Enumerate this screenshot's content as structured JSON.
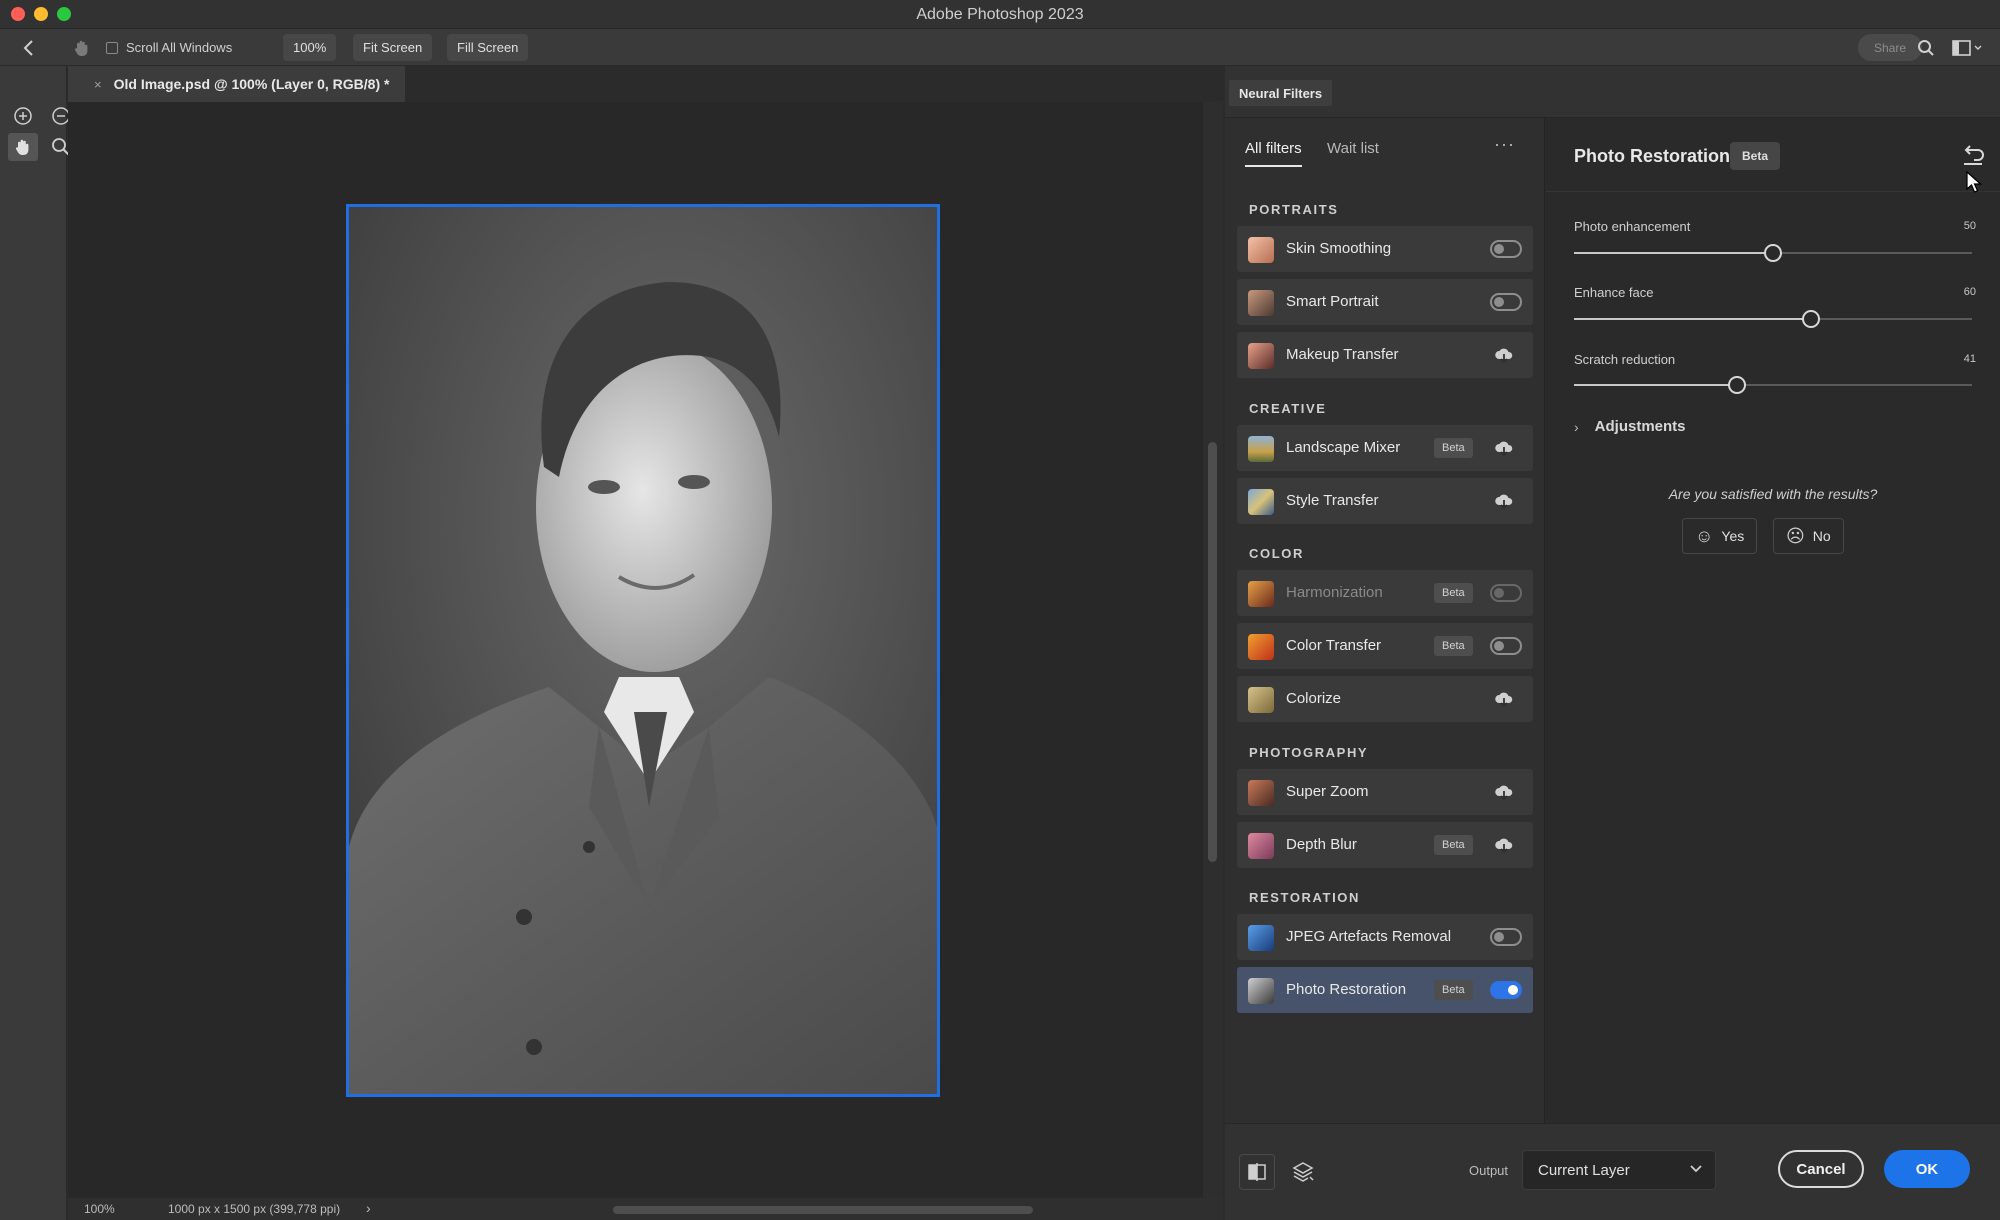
{
  "window": {
    "title": "Adobe Photoshop 2023"
  },
  "options_bar": {
    "scroll_all_windows": "Scroll All Windows",
    "zoom_100": "100%",
    "fit_screen": "Fit Screen",
    "fill_screen": "Fill Screen",
    "share": "Share"
  },
  "document": {
    "tab_title": "Old Image.psd @ 100% (Layer 0, RGB/8) *",
    "close_symbol": "×"
  },
  "status_bar": {
    "zoom": "100%",
    "doc_info": "1000 px x 1500 px (399,778 ppi)",
    "arrow": "›"
  },
  "neural_filters": {
    "panel_tab": "Neural Filters",
    "tabs": [
      "All filters",
      "Wait list"
    ],
    "more": "···",
    "beta_label": "Beta",
    "sections": [
      {
        "label": "PORTRAITS",
        "items": [
          {
            "name": "Skin Smoothing",
            "control": "toggle",
            "on": false
          },
          {
            "name": "Smart Portrait",
            "control": "toggle",
            "on": false
          },
          {
            "name": "Makeup Transfer",
            "control": "cloud"
          }
        ]
      },
      {
        "label": "CREATIVE",
        "items": [
          {
            "name": "Landscape Mixer",
            "beta": true,
            "control": "cloud"
          },
          {
            "name": "Style Transfer",
            "control": "cloud"
          }
        ]
      },
      {
        "label": "COLOR",
        "items": [
          {
            "name": "Harmonization",
            "beta": true,
            "control": "toggle",
            "on": false,
            "disabled": true
          },
          {
            "name": "Color Transfer",
            "beta": true,
            "control": "toggle",
            "on": false
          },
          {
            "name": "Colorize",
            "control": "cloud"
          }
        ]
      },
      {
        "label": "PHOTOGRAPHY",
        "items": [
          {
            "name": "Super Zoom",
            "control": "cloud"
          },
          {
            "name": "Depth Blur",
            "beta": true,
            "control": "cloud"
          }
        ]
      },
      {
        "label": "RESTORATION",
        "items": [
          {
            "name": "JPEG Artefacts Removal",
            "control": "toggle",
            "on": false
          },
          {
            "name": "Photo Restoration",
            "beta": true,
            "control": "toggle",
            "on": true,
            "selected": true
          }
        ]
      }
    ]
  },
  "settings": {
    "title": "Photo Restoration",
    "beta": "Beta",
    "sliders": [
      {
        "label": "Photo enhancement",
        "value": "50",
        "fraction": 0.5
      },
      {
        "label": "Enhance face",
        "value": "60",
        "fraction": 0.595
      },
      {
        "label": "Scratch reduction",
        "value": "41",
        "fraction": 0.41
      }
    ],
    "adjustments": "Adjustments",
    "feedback_question": "Are you satisfied with the results?",
    "yes": "Yes",
    "no": "No"
  },
  "bottom_bar": {
    "output_label": "Output",
    "output_value": "Current Layer",
    "cancel": "Cancel",
    "ok": "OK"
  },
  "colors": {
    "accent": "#1d74e8",
    "selection_border": "#1f6fe0",
    "panel_bg": "#2f2f2f"
  }
}
